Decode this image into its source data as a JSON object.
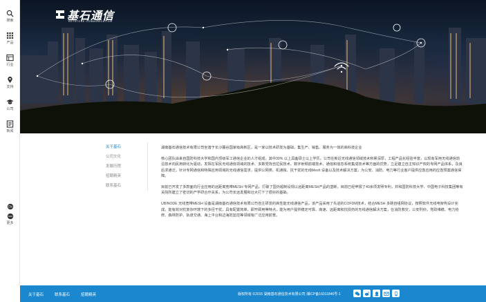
{
  "brand": {
    "name": "基石通信",
    "subtitle": "KEYSTONE COMMUNICATION"
  },
  "sidebar": {
    "items": [
      {
        "label": "搜索",
        "icon": "search-icon"
      },
      {
        "label": "产品",
        "icon": "grid-icon"
      },
      {
        "label": "行业",
        "icon": "industry-icon"
      },
      {
        "label": "支持",
        "icon": "location-pin-icon"
      },
      {
        "label": "公司",
        "icon": "graduation-cap-icon"
      },
      {
        "label": "新闻",
        "icon": "news-icon"
      }
    ],
    "more_label": "更多"
  },
  "subnav": {
    "items": [
      {
        "label": "关于基石",
        "active": true
      },
      {
        "label": "公司文化",
        "active": false
      },
      {
        "label": "发展历程",
        "active": false
      },
      {
        "label": "招聘精英",
        "active": false
      },
      {
        "label": "联系基石",
        "active": false
      }
    ]
  },
  "article": {
    "paragraphs": [
      "湖南基石通信技术有限公司坐落于长沙麓谷国家级高新区，是一家以技术研发为基础，集生产、销售、服务为一体的高科技企业",
      "核心团队由来自国防科技大学和国内顶级军工通信企业的人才组成，其中30% 以上具备硕士以上学历。公司在新近无线通信领域技术积累深厚，工程产品化经验丰富，以现有军用无线通信前沿技术向民用转化为驱动，发挥在军民无线通信领域的技术、多数党背自拉民技术、数字射频前端技术、通信和信息系统集成技术等方面的优势，立足建立自主知识产权的专网产品体系，及良后求通泛，针对专网通信和特殊应用领域的无线通信需求，提供公网类、机通独、抗干扰的无线Mesh 设备以及技术解决方案，为公安、消防、电力等行业客户提供应急应用的应急预案通信保障。",
      "目前已开发了多款面向行业应用的远距离宽带MESH 专网产品，打破了国外超制设规以远距离MESH产品的垄断，目前已经申报了40余项发明专利，并和国防科技大学、中国电子科技集团等有关院所建立了密切的产学研合作关系，为公司长远发展和壮大打下了很好的基础。",
      "UBINODE 无线宽带MESH 设备是湖南基石通信技术有限公司自主研发的高性能无线通信产品，该产品采用了先进的COFDM技术，结合MESH 多跳自组网协议，按照软件无线电架构设计完成。能有效对抗复杂环境下的多径干扰，具有配置简单，即开即用等特点，能为用户提供稳定可靠、高速、远距离和抗损伤的无线通信解决方案，在消防救灾，公安刑侦，党政维稳、电力抢修、森林防护、轨道交通、海上平台和边海防监控等领域有广泛应用前景。"
    ]
  },
  "footer": {
    "links": [
      "关于基石",
      "联系基石",
      "招聘精英"
    ],
    "copyright": "版权所有 ©2015 湖南基石通信技术有限公司 湘ICP备16011846号-1",
    "social": [
      {
        "name": "wechat-icon"
      },
      {
        "name": "weibo-icon"
      },
      {
        "name": "qq-icon"
      },
      {
        "name": "email-icon"
      },
      {
        "name": "phone-icon"
      }
    ]
  }
}
